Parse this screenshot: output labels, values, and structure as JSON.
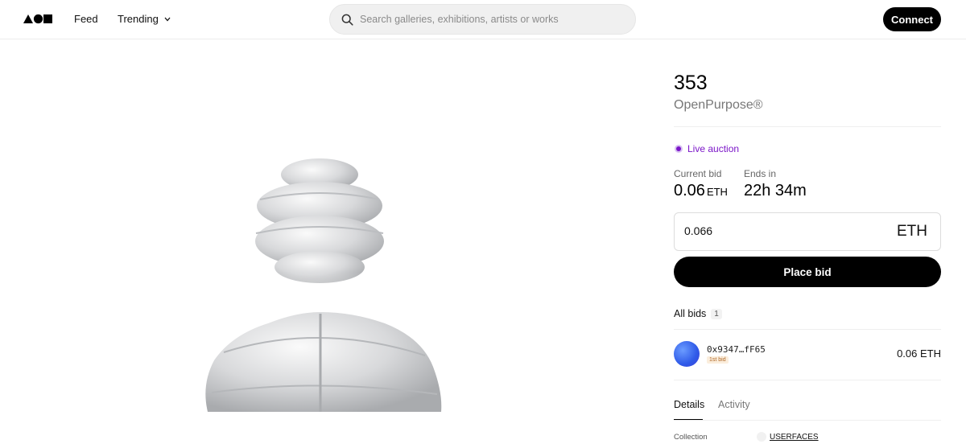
{
  "header": {
    "logo_name": "AOI-logo",
    "nav": {
      "feed": "Feed",
      "trending": "Trending"
    },
    "search": {
      "placeholder": "Search galleries, exhibitions, artists or works"
    },
    "connect_label": "Connect"
  },
  "artwork": {
    "title": "353",
    "creator": "OpenPurpose®"
  },
  "auction": {
    "status": "Live auction",
    "current_bid_label": "Current bid",
    "current_bid_value": "0.06",
    "current_bid_unit": "ETH",
    "ends_in_label": "Ends in",
    "ends_in_value": "22h 34m",
    "bid_input_value": "0.066",
    "bid_input_unit": "ETH",
    "place_bid_label": "Place bid"
  },
  "bids": {
    "label": "All bids",
    "count": "1",
    "items": [
      {
        "address": "0x9347…fF65",
        "tag": "1st bid",
        "amount": "0.06 ETH"
      }
    ]
  },
  "tabs": [
    {
      "label": "Details",
      "active": true
    },
    {
      "label": "Activity",
      "active": false
    }
  ],
  "details": {
    "collection_label": "Collection",
    "collection_value": "USERFACES"
  },
  "colors": {
    "accent_live": "#7b16c8",
    "button_bg": "#000000",
    "avatar_blue": "#2f5ae8"
  }
}
